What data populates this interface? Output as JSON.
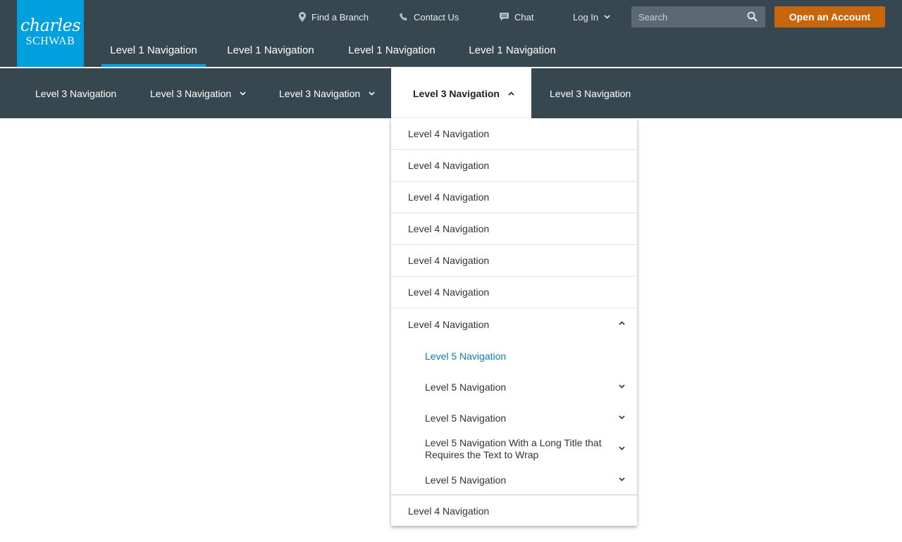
{
  "brand": {
    "line1": "charles",
    "line2": "SCHWAB",
    "color": "#00a0df"
  },
  "utility": {
    "find_branch": "Find a Branch",
    "contact_us": "Contact Us",
    "chat": "Chat",
    "log_in": "Log In",
    "search_placeholder": "Search",
    "open_account": "Open an Account"
  },
  "level1": [
    {
      "label": "Level 1 Navigation",
      "active": true
    },
    {
      "label": "Level 1 Navigation",
      "active": false
    },
    {
      "label": "Level 1 Navigation",
      "active": false
    },
    {
      "label": "Level 1 Navigation",
      "active": false
    }
  ],
  "level3": [
    {
      "label": "Level 3 Navigation",
      "has_children": false
    },
    {
      "label": "Level 3 Navigation",
      "has_children": true
    },
    {
      "label": "Level 3 Navigation",
      "has_children": true
    },
    {
      "label": "Level 3 Navigation",
      "has_children": true,
      "open": true
    },
    {
      "label": "Level 3 Navigation",
      "has_children": false
    }
  ],
  "dropdown": {
    "level4": [
      {
        "label": "Level 4 Navigation"
      },
      {
        "label": "Level 4 Navigation"
      },
      {
        "label": "Level 4 Navigation"
      },
      {
        "label": "Level 4 Navigation"
      },
      {
        "label": "Level 4 Navigation"
      },
      {
        "label": "Level 4 Navigation"
      },
      {
        "label": "Level 4 Navigation",
        "expanded": true
      },
      {
        "label": "Level 4 Navigation"
      }
    ],
    "level5": [
      {
        "label": "Level 5 Navigation",
        "active": true
      },
      {
        "label": "Level 5 Navigation"
      },
      {
        "label": "Level 5 Navigation"
      },
      {
        "label": "Level 5 Navigation With a Long Title that Requires the Text to Wrap"
      },
      {
        "label": "Level 5 Navigation"
      }
    ]
  },
  "colors": {
    "header_bg": "#37474f",
    "accent": "#00a0df",
    "cta": "#c9660b",
    "active_link": "#0f7ea6"
  }
}
